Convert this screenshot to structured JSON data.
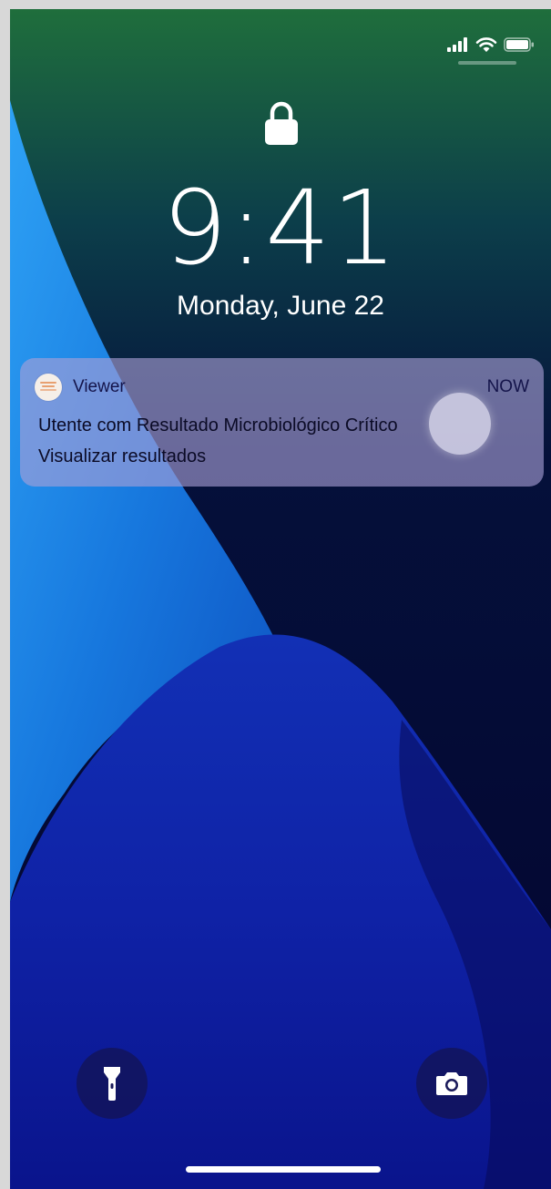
{
  "status_bar": {
    "icons": [
      "cellular-signal-icon",
      "wifi-icon",
      "battery-icon"
    ]
  },
  "lock_screen": {
    "lock_icon": "lock-icon",
    "time": "9:41",
    "date": "Monday, June 22"
  },
  "notification": {
    "app_icon": "viewer-app-icon",
    "app_name": "Viewer",
    "time": "NOW",
    "title": "Utente com Resultado Microbiológico Crítico",
    "body": "Visualizar resultados"
  },
  "quick_actions": {
    "left": "flashlight-icon",
    "right": "camera-icon"
  },
  "colors": {
    "notification_bg": "#a9a0d6",
    "wallpaper_light_blue": "#1a8de8",
    "wallpaper_dark_navy": "#06063a",
    "wallpaper_green": "#1f6e3c"
  }
}
